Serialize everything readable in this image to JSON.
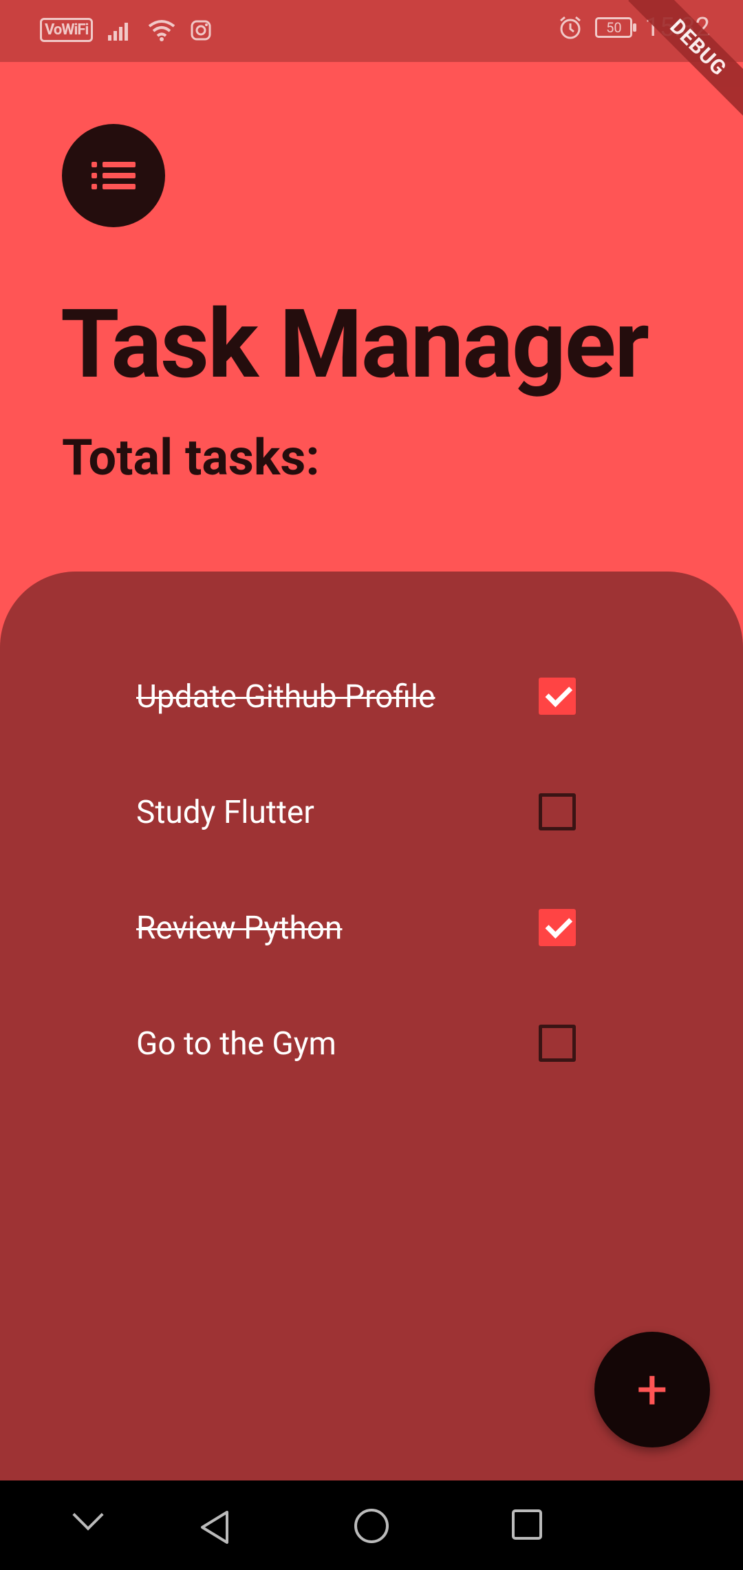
{
  "status_bar": {
    "network_label": "VoWiFi",
    "battery_level": "50",
    "time": "15:32"
  },
  "debug_ribbon": "DEBUG",
  "header": {
    "title": "Task Manager",
    "subtitle": "Total tasks:"
  },
  "tasks": [
    {
      "label": "Update Github Profile",
      "done": true
    },
    {
      "label": "Study Flutter",
      "done": false
    },
    {
      "label": "Review Python",
      "done": true
    },
    {
      "label": "Go to the Gym",
      "done": false
    }
  ],
  "fab": {
    "icon": "plus-icon",
    "symbol": "+"
  },
  "colors": {
    "background": "#FF5555",
    "panel": "#9E3334",
    "dark": "#240D0D",
    "checked": "#FF4444"
  }
}
